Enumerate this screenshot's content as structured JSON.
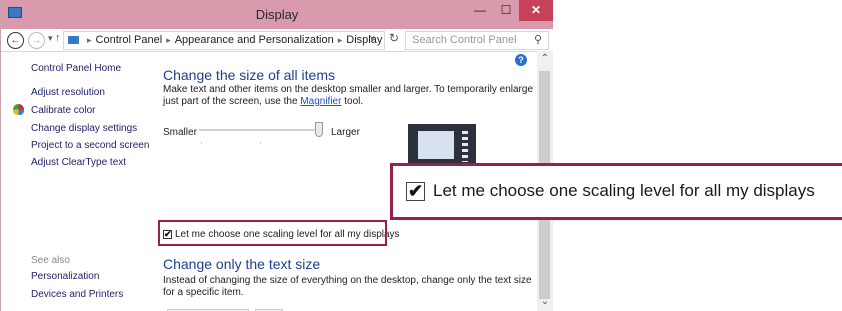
{
  "window": {
    "title": "Display",
    "controls": {
      "minimize": "—",
      "maximize": "☐",
      "close": "✕"
    }
  },
  "address_bar": {
    "segments": [
      "Control Panel",
      "Appearance and Personalization",
      "Display"
    ],
    "search_placeholder": "Search Control Panel"
  },
  "sidebar": {
    "home": "Control Panel Home",
    "items": [
      "Adjust resolution",
      "Calibrate color",
      "Change display settings",
      "Project to a second screen",
      "Adjust ClearType text"
    ],
    "see_also_label": "See also",
    "see_also_items": [
      "Personalization",
      "Devices and Printers"
    ]
  },
  "main": {
    "heading1": "Change the size of all items",
    "desc1_part1": "Make text and other items on the desktop smaller and larger. To temporarily enlarge just part of the screen, use the",
    "desc1_link": "Magnifier",
    "desc1_part2": "tool.",
    "slider": {
      "min_label": "Smaller",
      "max_label": "Larger",
      "level": 1.0
    },
    "checkbox": {
      "label": "Let me choose one scaling level for all my displays",
      "checked": true,
      "mark": "✔"
    },
    "heading2": "Change only the text size",
    "desc2": "Instead of changing the size of everything on the desktop, change only the text size for a specific item."
  },
  "callout": {
    "label": "Let me choose one scaling level for all my displays",
    "mark": "✔"
  },
  "colors": {
    "titlebar": "#d99aac",
    "close": "#c7415a",
    "highlight_border": "#9b1f4e",
    "heading": "#1e3f8f",
    "link": "#1d50c4"
  }
}
